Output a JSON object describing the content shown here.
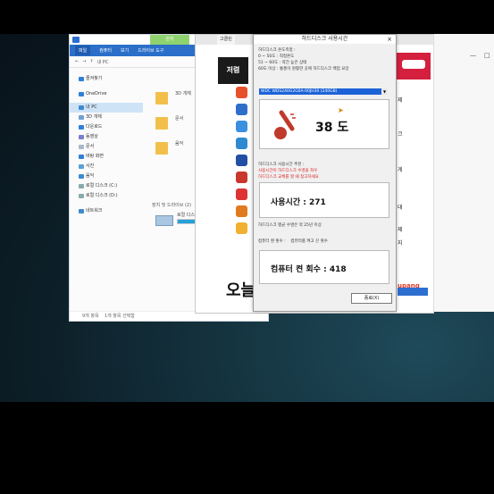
{
  "explorer": {
    "ribbon_tabs": [
      "파일",
      "컴퓨터",
      "보기"
    ],
    "tool_tab": "관리",
    "drive_tools": "드라이브 도구",
    "address": "내 PC",
    "nav_items": [
      {
        "label": "즐겨찾기",
        "color": "#2f7fd8"
      },
      {
        "label": "OneDrive",
        "color": "#2f7fd8"
      },
      {
        "label": "내 PC",
        "color": "#3d8bd0"
      },
      {
        "label": "3D 개체",
        "color": "#6fa0d8"
      },
      {
        "label": "다운로드",
        "color": "#2f7fd8"
      },
      {
        "label": "동영상",
        "color": "#7a7fd0"
      },
      {
        "label": "문서",
        "color": "#a9b8c8"
      },
      {
        "label": "바탕 화면",
        "color": "#2f7fd8"
      },
      {
        "label": "사진",
        "color": "#5aa0d8"
      },
      {
        "label": "음악",
        "color": "#3d8bd0"
      },
      {
        "label": "로컬 디스크 (C:)",
        "color": "#8aa"
      },
      {
        "label": "로컬 디스크 (D:)",
        "color": "#8aa"
      },
      {
        "label": "네트워크",
        "color": "#3d8bd0"
      }
    ],
    "folders": [
      "3D 개체",
      "문서",
      "음악"
    ],
    "group_header": "장치 및 드라이브 (2)",
    "drive_label": "로컬 디스크 (C:)",
    "drive_fill": 0.6,
    "status_left": "9개 항목",
    "status_right": "1개 항목 선택함"
  },
  "web": {
    "tab1": "고클린",
    "banner_text": "저렴",
    "big_text": "오늘",
    "coupang_label": "upang",
    "side_texts": [
      "제",
      "크",
      "게",
      "대",
      "제",
      "지",
      "지"
    ]
  },
  "dialog": {
    "title": "하드디스크 사용시간",
    "close": "×",
    "legend_title": "하드디스크 온도측정 :",
    "legend_lines": [
      "0 ~ 50도 : 적정온도",
      "51 ~ 60도 : 약간 높은 상태",
      "60도 이상 : 통풍이 원활한 곳에 하드디스크 백업 요망"
    ],
    "disk_select": "WDC WDS240G2G0A-00JH30 (240GB)",
    "temperature": "38 도",
    "recommend_title": "하드디스크 사용시간 추천 :",
    "recommend_lines": [
      "사용시간이 하드디스크 수명을 좌우",
      "하드디스크 교체를 할 때 참고하세요"
    ],
    "usage_time": "사용시간 : 271",
    "average": "하드디스크 평균 수명은 약 25년 이상",
    "count_label": "컴퓨터 켠 횟수 :",
    "count_label_suffix": "컴퓨터를 켜고 끈 횟수",
    "power_count": "컴퓨터 켠 회수 : 418",
    "ok_button": "종료(X)"
  }
}
